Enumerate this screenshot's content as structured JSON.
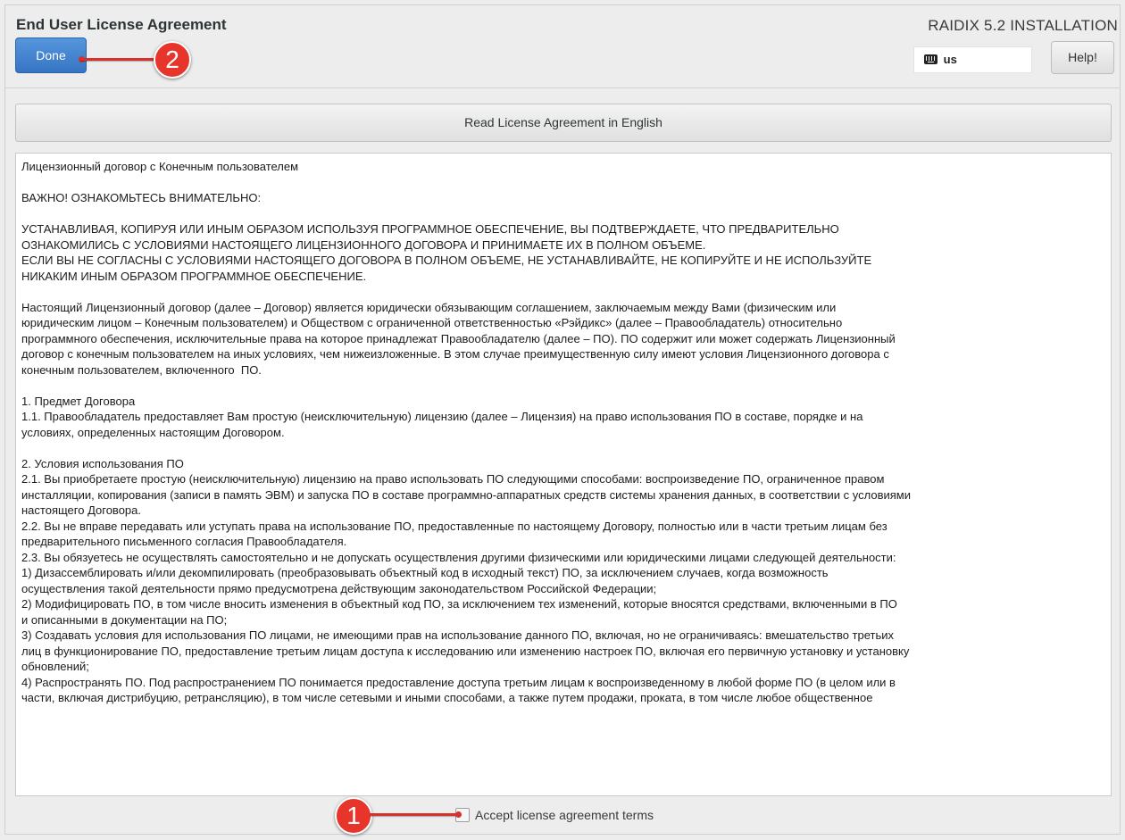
{
  "window": {
    "title": "End User License Agreement",
    "product": "RAIDIX 5.2 INSTALLATION"
  },
  "header": {
    "done_label": "Done",
    "keyboard_layout": "us",
    "help_label": "Help!"
  },
  "read_english_label": "Read License Agreement in English",
  "license_paragraphs": [
    "Лицензионный договор с Конечным пользователем",
    "",
    "ВАЖНО! ОЗНАКОМЬТЕСЬ ВНИМАТЕЛЬНО:",
    "",
    "УСТАНАВЛИВАЯ, КОПИРУЯ ИЛИ ИНЫМ ОБРАЗОМ ИСПОЛЬЗУЯ ПРОГРАММНОЕ ОБЕСПЕЧЕНИЕ, ВЫ ПОДТВЕРЖДАЕТЕ, ЧТО ПРЕДВАРИТЕЛЬНО\nОЗНАКОМИЛИСЬ С УСЛОВИЯМИ НАСТОЯЩЕГО ЛИЦЕНЗИОННОГО ДОГОВОРА И ПРИНИМАЕТЕ ИХ В ПОЛНОМ ОБЪЕМЕ.\nЕСЛИ ВЫ НЕ СОГЛАСНЫ С УСЛОВИЯМИ НАСТОЯЩЕГО ДОГОВОРА В ПОЛНОМ ОБЪЕМЕ, НЕ УСТАНАВЛИВАЙТЕ, НЕ КОПИРУЙТЕ И НЕ ИСПОЛЬЗУЙТЕ\nНИКАКИМ ИНЫМ ОБРАЗОМ ПРОГРАММНОЕ ОБЕСПЕЧЕНИЕ.",
    "",
    "Настоящий Лицензионный договор (далее – Договор) является юридически обязывающим соглашением, заключаемым между Вами (физическим или\nюридическим лицом – Конечным пользователем) и Обществом с ограниченной ответственностью «Рэйдикс» (далее – Правообладатель) относительно\nпрограммного обеспечения, исключительные права на которое принадлежат Правообладателю (далее – ПО). ПО содержит или может содержать Лицензионный\nдоговор с конечным пользователем на иных условиях, чем нижеизложенные. В этом случае преимущественную силу имеют условия Лицензионного договора с\nконечным пользователем, включенного  ПО.",
    "",
    "1. Предмет Договора\n1.1. Правообладатель предоставляет Вам простую (неисключительную) лицензию (далее – Лицензия) на право использования ПО в составе, порядке и на\nусловиях, определенных настоящим Договором.",
    "",
    "2. Условия использования ПО\n2.1. Вы приобретаете простую (неисключительную) лицензию на право использовать ПО следующими способами: воспроизведение ПО, ограниченное правом\nинсталляции, копирования (записи в память ЭВМ) и запуска ПО в составе программно-аппаратных средств системы хранения данных, в соответствии с условиями\nнастоящего Договора.\n2.2. Вы не вправе передавать или уступать права на использование ПО, предоставленные по настоящему Договору, полностью или в части третьим лицам без\nпредварительного письменного согласия Правообладателя.\n2.3. Вы обязуетесь не осуществлять самостоятельно и не допускать осуществления другими физическими или юридическими лицами следующей деятельности:\n1) Дизассемблировать и/или декомпилировать (преобразовывать объектный код в исходный текст) ПО, за исключением случаев, когда возможность\nосуществления такой деятельности прямо предусмотрена действующим законодательством Российской Федерации;\n2) Модифицировать ПО, в том числе вносить изменения в объектный код ПО, за исключением тех изменений, которые вносятся средствами, включенными в ПО\nи описанными в документации на ПО;\n3) Создавать условия для использования ПО лицами, не имеющими прав на использование данного ПО, включая, но не ограничиваясь: вмешательство третьих\nлиц в функционирование ПО, предоставление третьим лицам доступа к исследованию или изменению настроек ПО, включая его первичную установку и установку\nобновлений;\n4) Распространять ПО. Под распространением ПО понимается предоставление доступа третьим лицам к воспроизведенному в любой форме ПО (в целом или в\nчасти, включая дистрибуцию, ретрансляцию), в том числе сетевыми и иными способами, а также путем продажи, проката, в том числе любое общественное"
  ],
  "accept_label": "Accept license agreement terms",
  "annotations": {
    "callout_1": "1",
    "callout_2": "2",
    "color": "#e8352c"
  },
  "colors": {
    "done_button": "#3675c4",
    "background": "#ededed"
  }
}
